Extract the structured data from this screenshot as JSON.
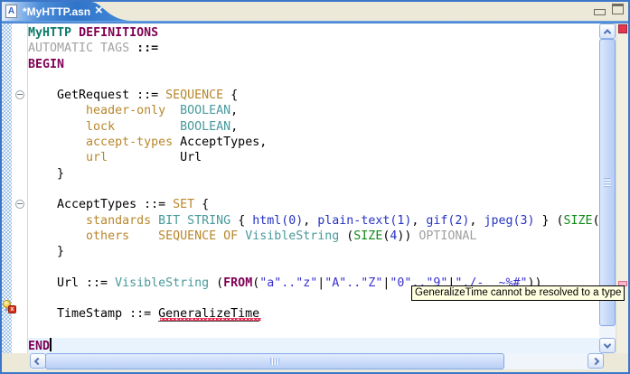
{
  "tab": {
    "title": "*MyHTTP.asn",
    "icon_letter": "A",
    "close_label": "×"
  },
  "tooltip": {
    "text": "GeneralizeTime cannot be resolved to a type"
  },
  "colors": {
    "keyword": "#7F0055",
    "module": "#0B7A6B",
    "type": "#4A9A9C",
    "field": "#B8872B",
    "number": "#2633C4",
    "string": "#3A31CE",
    "size": "#108A18",
    "optional": "#9FA0A0",
    "gray": "#A2A2A2",
    "tab_blue": "#2F74C8",
    "error_red": "#E8244C"
  },
  "editor": {
    "language": "ASN.1",
    "lines": [
      {
        "tokens": [
          {
            "t": "MyHTTP",
            "c": "mod"
          },
          {
            "t": " ",
            "c": "plain"
          },
          {
            "t": "DEFINITIONS",
            "c": "kw"
          }
        ]
      },
      {
        "tokens": [
          {
            "t": "AUTOMATIC TAGS",
            "c": "gray"
          },
          {
            "t": " ",
            "c": "plain"
          },
          {
            "t": "::=",
            "c": "op"
          }
        ]
      },
      {
        "tokens": [
          {
            "t": "BEGIN",
            "c": "kw"
          }
        ]
      },
      {
        "tokens": []
      },
      {
        "fold": true,
        "tokens": [
          {
            "t": "    GetRequest ::= ",
            "c": "plain"
          },
          {
            "t": "SEQUENCE",
            "c": "field"
          },
          {
            "t": " {",
            "c": "plain"
          }
        ]
      },
      {
        "tokens": [
          {
            "t": "        ",
            "c": "plain"
          },
          {
            "t": "header-only",
            "c": "field"
          },
          {
            "t": "  ",
            "c": "plain"
          },
          {
            "t": "BOOLEAN",
            "c": "type"
          },
          {
            "t": ",",
            "c": "plain"
          }
        ]
      },
      {
        "tokens": [
          {
            "t": "        ",
            "c": "plain"
          },
          {
            "t": "lock",
            "c": "field"
          },
          {
            "t": "         ",
            "c": "plain"
          },
          {
            "t": "BOOLEAN",
            "c": "type"
          },
          {
            "t": ",",
            "c": "plain"
          }
        ]
      },
      {
        "tokens": [
          {
            "t": "        ",
            "c": "plain"
          },
          {
            "t": "accept-types",
            "c": "field"
          },
          {
            "t": " ",
            "c": "plain"
          },
          {
            "t": "AcceptTypes,",
            "c": "plain"
          }
        ]
      },
      {
        "tokens": [
          {
            "t": "        ",
            "c": "plain"
          },
          {
            "t": "url",
            "c": "field"
          },
          {
            "t": "          ",
            "c": "plain"
          },
          {
            "t": "Url",
            "c": "plain"
          }
        ]
      },
      {
        "tokens": [
          {
            "t": "    }",
            "c": "plain"
          }
        ]
      },
      {
        "tokens": []
      },
      {
        "fold": true,
        "tokens": [
          {
            "t": "    AcceptTypes ::= ",
            "c": "plain"
          },
          {
            "t": "SET",
            "c": "field"
          },
          {
            "t": " {",
            "c": "plain"
          }
        ]
      },
      {
        "tokens": [
          {
            "t": "        ",
            "c": "plain"
          },
          {
            "t": "standards",
            "c": "field"
          },
          {
            "t": " ",
            "c": "plain"
          },
          {
            "t": "BIT STRING",
            "c": "type"
          },
          {
            "t": " { ",
            "c": "plain"
          },
          {
            "t": "html(0)",
            "c": "num"
          },
          {
            "t": ", ",
            "c": "plain"
          },
          {
            "t": "plain-text(1)",
            "c": "num"
          },
          {
            "t": ", ",
            "c": "plain"
          },
          {
            "t": "gif(2)",
            "c": "num"
          },
          {
            "t": ", ",
            "c": "plain"
          },
          {
            "t": "jpeg(3)",
            "c": "num"
          },
          {
            "t": " } (",
            "c": "plain"
          },
          {
            "t": "SIZE",
            "c": "size"
          },
          {
            "t": "(",
            "c": "plain"
          }
        ]
      },
      {
        "tokens": [
          {
            "t": "        ",
            "c": "plain"
          },
          {
            "t": "others",
            "c": "field"
          },
          {
            "t": "    ",
            "c": "plain"
          },
          {
            "t": "SEQUENCE OF",
            "c": "field"
          },
          {
            "t": " ",
            "c": "plain"
          },
          {
            "t": "VisibleString",
            "c": "type"
          },
          {
            "t": " (",
            "c": "plain"
          },
          {
            "t": "SIZE",
            "c": "size"
          },
          {
            "t": "(",
            "c": "plain"
          },
          {
            "t": "4",
            "c": "num"
          },
          {
            "t": "))",
            "c": "plain"
          },
          {
            "t": " ",
            "c": "plain"
          },
          {
            "t": "OPTIONAL",
            "c": "opt"
          }
        ]
      },
      {
        "tokens": [
          {
            "t": "    }",
            "c": "plain"
          }
        ]
      },
      {
        "tokens": []
      },
      {
        "tokens": [
          {
            "t": "    Url ::= ",
            "c": "plain"
          },
          {
            "t": "VisibleString",
            "c": "type"
          },
          {
            "t": " (",
            "c": "plain"
          },
          {
            "t": "FROM",
            "c": "kw"
          },
          {
            "t": "(",
            "c": "plain"
          },
          {
            "t": "\"a\"..\"z\"",
            "c": "str"
          },
          {
            "t": "|",
            "c": "plain"
          },
          {
            "t": "\"A\"..\"Z\"",
            "c": "str"
          },
          {
            "t": "|",
            "c": "plain"
          },
          {
            "t": "\"0\"..\"9\"",
            "c": "str"
          },
          {
            "t": "|",
            "c": "plain"
          },
          {
            "t": "\"./-_ ~%#\"",
            "c": "str"
          },
          {
            "t": "))",
            "c": "plain"
          }
        ]
      },
      {
        "tokens": []
      },
      {
        "error": true,
        "tokens": [
          {
            "t": "    TimeStamp ::= ",
            "c": "plain"
          },
          {
            "t": "GeneralizeTime",
            "c": "err"
          }
        ]
      },
      {
        "tokens": []
      },
      {
        "current": true,
        "cursor": true,
        "tokens": [
          {
            "t": "END",
            "c": "kw"
          }
        ]
      }
    ]
  }
}
